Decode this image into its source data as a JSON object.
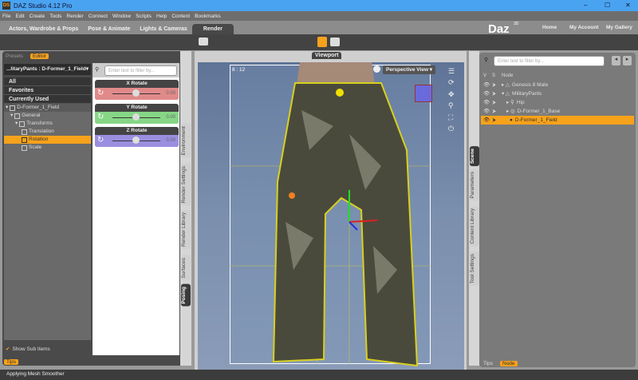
{
  "window": {
    "title": "DAZ Studio 4.12 Pro",
    "app_icon": "DS",
    "minimize": "–",
    "maximize": "☐",
    "close": "✕"
  },
  "menu": [
    "File",
    "Edit",
    "Create",
    "Tools",
    "Render",
    "Connect",
    "Window",
    "Scripts",
    "Help",
    "Content",
    "Bookmarks"
  ],
  "main_tabs": [
    {
      "label": "Actors, Wardrobe & Props"
    },
    {
      "label": "Pose & Animate"
    },
    {
      "label": "Lights & Cameras"
    },
    {
      "label": "Render",
      "active": true
    }
  ],
  "brand": {
    "logo": "Daz",
    "superscript": "3D",
    "links": [
      "Home",
      "My Account",
      "My Gallery"
    ]
  },
  "left_panel": {
    "tabs": [
      "Presets",
      "Editor"
    ],
    "active_tab": "Editor",
    "node_selector": "...litaryPants : D-Former_1_Field",
    "categories": [
      "All",
      "Favorites",
      "Currently Used"
    ],
    "tree": [
      {
        "label": "D-Former_1_Field",
        "level": 0
      },
      {
        "label": "General",
        "level": 1
      },
      {
        "label": "Transforms",
        "level": 2
      },
      {
        "label": "Translation",
        "level": 3
      },
      {
        "label": "Rotation",
        "level": 3,
        "selected": true
      },
      {
        "label": "Scale",
        "level": 3
      }
    ],
    "filter_placeholder": "Enter text to filter by...",
    "params": [
      {
        "label": "X Rotate",
        "value": "0.00",
        "color": "#e08a8a"
      },
      {
        "label": "Y Rotate",
        "value": "0.00",
        "color": "#86d686"
      },
      {
        "label": "Z Rotate",
        "value": "0.00",
        "color": "#9a8ee0"
      }
    ],
    "show_sub_items": "Show Sub Items",
    "show_sub_items_checked": true,
    "tips": "Tips",
    "side_tabs": [
      "Environment",
      "Render Settings",
      "Render Library",
      "Surfaces",
      "Posing"
    ],
    "active_side_tab": "Posing"
  },
  "viewport": {
    "tab": "Viewport",
    "aspect": "8 : 12",
    "view": "Perspective View"
  },
  "right_panel": {
    "filter_placeholder": "Enter text to filter by...",
    "columns": [
      "V",
      "S",
      "Node"
    ],
    "nodes": [
      {
        "label": "Genesis 8 Male",
        "level": 0
      },
      {
        "label": "MilitaryPants",
        "level": 0
      },
      {
        "label": "Hip",
        "level": 1
      },
      {
        "label": "D-Former_1_Base",
        "level": 1
      },
      {
        "label": "D-Former_1_Field",
        "level": 1,
        "selected": true
      }
    ],
    "side_tabs": [
      "Scene",
      "Parameters",
      "Content Library",
      "Tool Settings"
    ],
    "active_side_tab": "Scene",
    "bottom_tabs": [
      "Tips",
      "Node"
    ]
  },
  "status": "Applying Mesh Smoother",
  "colors": {
    "accent": "#f7a21b",
    "title_bar": "#4aa3f0"
  }
}
